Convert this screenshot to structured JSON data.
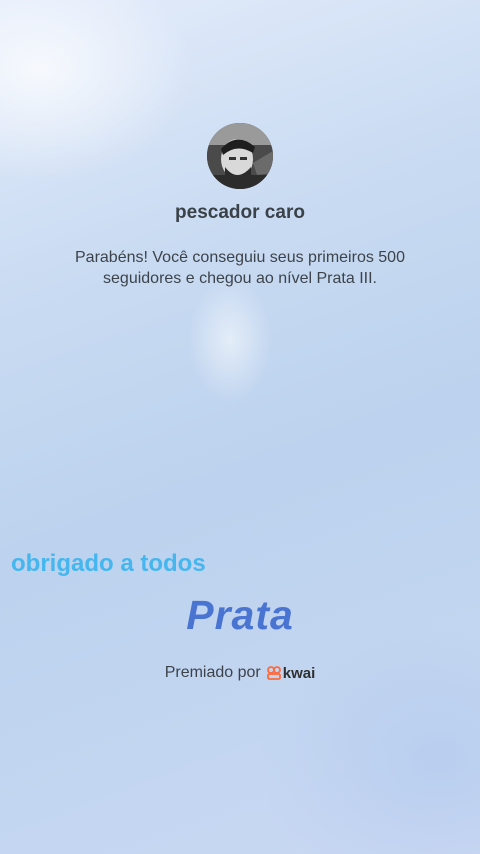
{
  "profile": {
    "username": "pescador caro",
    "avatar_icon": "user-photo"
  },
  "message": {
    "text": "Parabéns! Você conseguiu seus primeiros 500 seguidores e chegou ao nível Prata III."
  },
  "overlay": {
    "text": "obrigado a todos",
    "color": "#45b6ee"
  },
  "level": {
    "name": "Prata",
    "color": "#4a74d2"
  },
  "awarded": {
    "label": "Premiado por",
    "brand": "kwai",
    "brand_color": "#ff6a3d"
  }
}
